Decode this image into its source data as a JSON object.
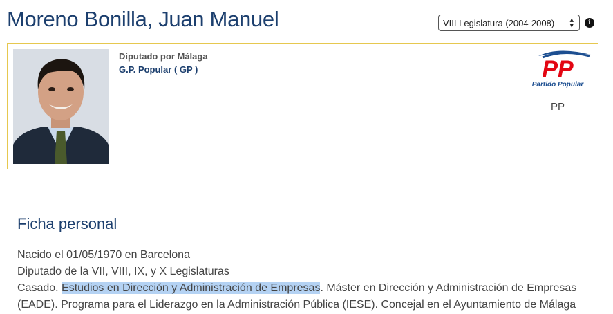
{
  "header": {
    "title": "Moreno Bonilla, Juan Manuel",
    "legislature_select": {
      "selected": "VIII Legislatura (2004-2008)"
    }
  },
  "card": {
    "deputy_for": "Diputado por Málaga",
    "group": "G.P. Popular ( GP )",
    "party_logo_text": "Partido Popular",
    "party_logo_initials": "PP",
    "party_abbr": "PP"
  },
  "ficha": {
    "title": "Ficha personal",
    "birth": "Nacido el 01/05/1970 en Barcelona",
    "legislatures": "Diputado de la VII, VIII, IX, y X Legislaturas",
    "line3_before": "Casado. ",
    "line3_highlight": "Estudios en Dirección y Administración de Empresas",
    "line3_after": ". Máster en Dirección y Administración de Empresas",
    "line4": "(EADE). Programa para el Liderazgo en la Administración Pública (IESE). Concejal en el Ayuntamiento de Málaga"
  },
  "colors": {
    "title_blue": "#1c3f6e",
    "card_border": "#e6c84f",
    "pp_red": "#e30613",
    "pp_blue": "#1d4f91",
    "selection": "#b4d2f3"
  }
}
